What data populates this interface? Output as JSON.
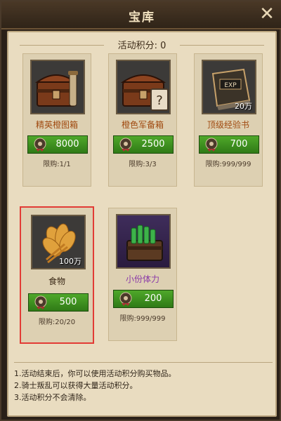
{
  "window": {
    "title": "宝库"
  },
  "score": {
    "label": "活动积分: 0"
  },
  "items": [
    {
      "name": "精英橙图箱",
      "price": "8000",
      "limit": "限购:1/1"
    },
    {
      "name": "橙色军备箱",
      "price": "2500",
      "limit": "限购:3/3"
    },
    {
      "name": "顶级经验书",
      "price": "700",
      "limit": "限购:999/999",
      "badge": "20万"
    },
    {
      "name": "食物",
      "price": "500",
      "limit": "限购:20/20",
      "badge": "100万"
    },
    {
      "name": "小份体力",
      "price": "200",
      "limit": "限购:999/999"
    }
  ],
  "notes": [
    "1.活动结束后，你可以使用活动积分购买物品。",
    "2.骑士叛乱可以获得大量活动积分。",
    "3.活动积分不会清除。"
  ],
  "colors": {
    "buy_button": "#3f8f1f",
    "selection_outline": "#e23b35",
    "panel_bg": "#e9dcc0"
  }
}
